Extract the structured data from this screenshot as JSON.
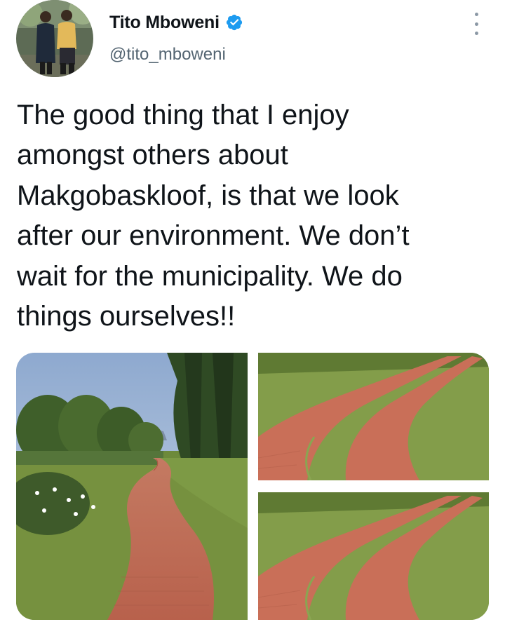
{
  "tweet": {
    "author": {
      "display_name": "Tito Mboweni",
      "handle": "@tito_mboweni",
      "verified": true,
      "avatar_icon": "profile-photo",
      "verified_icon": "verified-badge-icon"
    },
    "more_icon": "more-options-icon",
    "text": "The good thing that I enjoy\namongst others about\nMakgobaskloof, is that we look\nafter our environment. We don’t\nwait for the municipality. We do\nthings ourselves!!",
    "media": [
      {
        "name": "photo-brick-road-trees"
      },
      {
        "name": "photo-brick-road-grass-1"
      },
      {
        "name": "photo-brick-road-grass-2"
      }
    ]
  },
  "colors": {
    "text": "#0f1419",
    "secondary_text": "#536471",
    "verified_blue": "#1d9bf0",
    "brick": "#c9715a",
    "grass": "#6f8f3f"
  }
}
